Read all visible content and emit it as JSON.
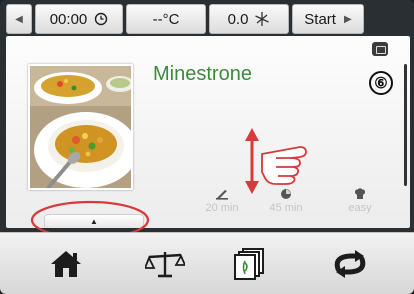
{
  "topbar": {
    "left_arrow_icon": "triangle-left",
    "time": "00:00",
    "time_icon": "clock-icon",
    "temperature": "--°C",
    "speed": "0.0",
    "speed_icon": "fan-icon",
    "start_label": "Start",
    "right_arrow_icon": "triangle-right"
  },
  "recipe": {
    "title": "Minestrone",
    "image_icon": "soup-bowl-photo",
    "badge": "⑥",
    "stats": [
      {
        "icon": "knife-icon",
        "label": "20 min"
      },
      {
        "icon": "timer-icon",
        "label": "45 min"
      },
      {
        "icon": "chef-hat-icon",
        "label": "easy"
      }
    ],
    "tab_handle_icon": "triangle-up"
  },
  "annotations": {
    "arrow_color": "#d8393a",
    "ellipse_color": "#d8393a"
  },
  "bottom_nav": [
    {
      "icon": "home-icon"
    },
    {
      "icon": "scale-icon"
    },
    {
      "icon": "recipe-cards-icon"
    },
    {
      "icon": "repeat-icon"
    }
  ],
  "colors": {
    "title_green": "#3c8c3a",
    "stat_gray": "#c4c4c4",
    "annotation_red": "#d8393a"
  }
}
